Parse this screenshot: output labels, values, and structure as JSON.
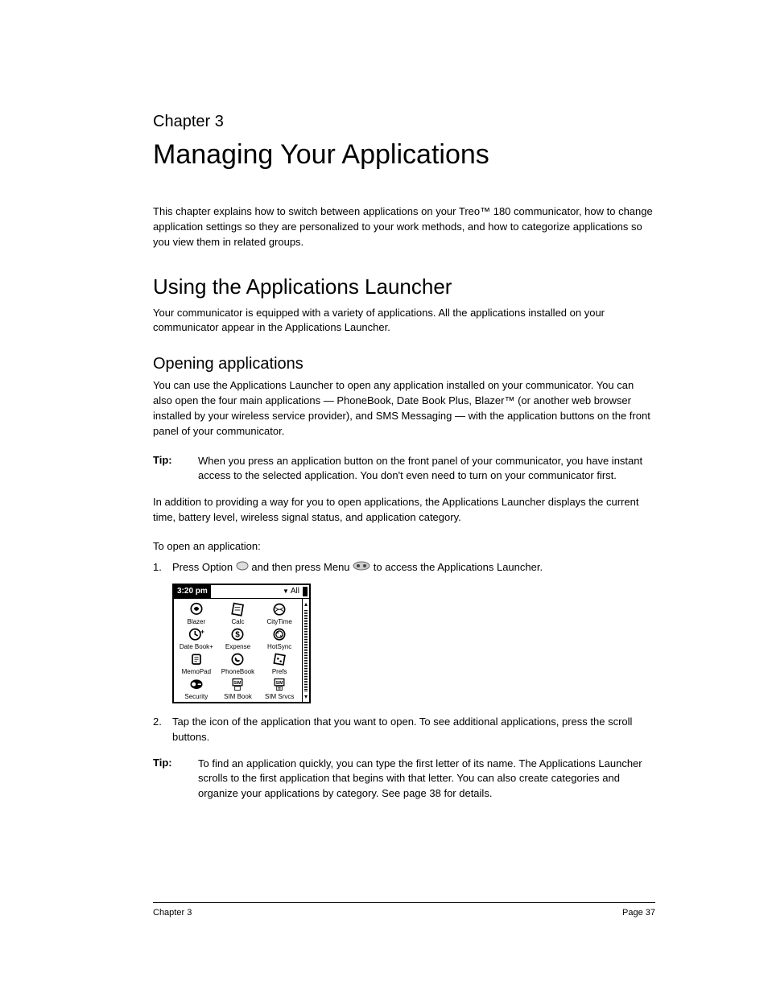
{
  "chapter_label": "Chapter 3",
  "chapter_title": "Managing Your Applications",
  "intro": "This chapter explains how to switch between applications on your Treo™ 180 communicator, how to change application settings so they are personalized to your work methods, and how to categorize applications so you view them in related groups.",
  "section1": {
    "heading": "Using the Applications Launcher",
    "body": "Your communicator is equipped with a variety of applications. All the applications installed on your communicator appear in the Applications Launcher."
  },
  "section2": {
    "heading": "Opening applications",
    "body": "You can use the Applications Launcher to open any application installed on your communicator. You can also open the four main applications — PhoneBook, Date Book Plus, Blazer™ (or another web browser installed by your wireless service provider), and SMS Messaging — with the application buttons on the front panel of your communicator."
  },
  "tip1": {
    "label": "Tip:",
    "body": "When you press an application button on the front panel of your communicator, you have instant access to the selected application. You don't even need to turn on your communicator first."
  },
  "para2": "In addition to providing a way for you to open applications, the Applications Launcher displays the current time, battery level, wireless signal status, and application category.",
  "subhead": "To open an application:",
  "step1": {
    "num": "1.",
    "pre": "Press Option ",
    "mid": " and then press Menu ",
    "post": " to access the Applications Launcher."
  },
  "pda": {
    "time": "3:20 pm",
    "category": "All",
    "apps": [
      "Blazer",
      "Calc",
      "CityTime",
      "Date Book+",
      "Expense",
      "HotSync",
      "MemoPad",
      "PhoneBook",
      "Prefs",
      "Security",
      "SIM Book",
      "SIM Srvcs"
    ]
  },
  "step2": {
    "num": "2.",
    "body": "Tap the icon of the application that you want to open. To see additional applications, press the scroll buttons."
  },
  "tip2": {
    "label": "Tip:",
    "body": "To find an application quickly, you can type the first letter of its name. The Applications Launcher scrolls to the first application that begins with that letter. You can also create categories and organize your applications by category. See page 38 for details."
  },
  "footer": {
    "left": "Chapter 3",
    "right": "Page 37"
  }
}
